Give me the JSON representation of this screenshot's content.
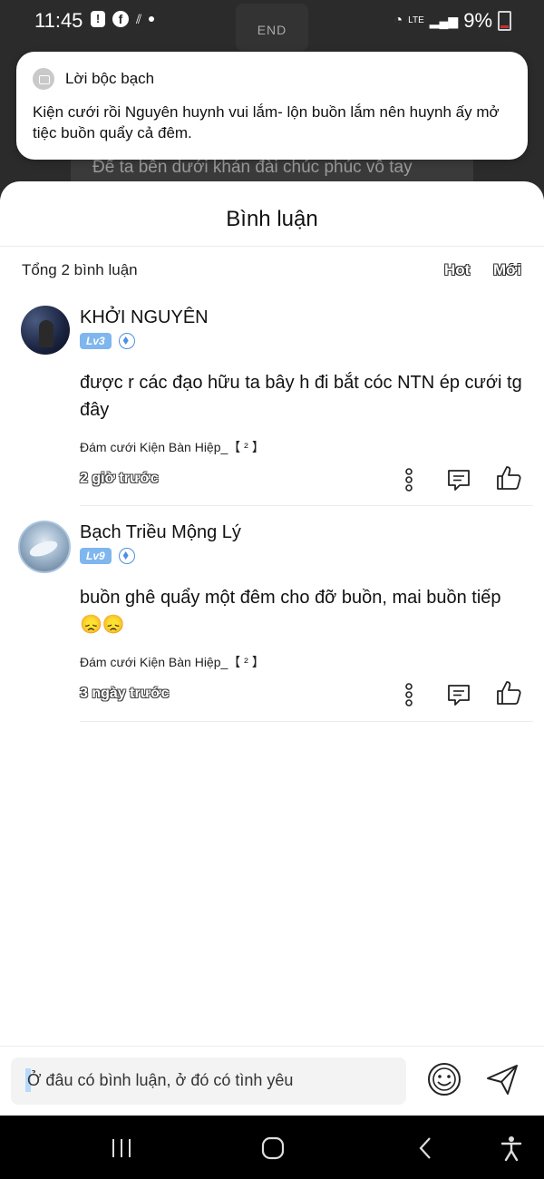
{
  "status_bar": {
    "time": "11:45",
    "center_pill": "END",
    "battery": "9%",
    "network": "LTE"
  },
  "background": {
    "caption": "Để ta bên dưới khán đài chúc phúc vô tay"
  },
  "notification": {
    "title": "Lời bộc bạch",
    "body": "Kiện cưới rồi Nguyên huynh vui lắm- lộn buồn lắm nên huynh ấy mở tiệc buồn quẩy cả đêm."
  },
  "sheet": {
    "title": "Bình luận",
    "count": "Tổng 2 bình luận",
    "sort_hot": "Hot",
    "sort_new": "Mới"
  },
  "comments": [
    {
      "name": "KHỞI NGUYÊN",
      "level": "Lv3",
      "text": "được r các đạo hữu ta bây h đi bắt cóc NTN ép cưới tg đây",
      "source": "Đám cưới Kiện Bàn Hiệp_【 ² 】",
      "time": "2 giờ trước"
    },
    {
      "name": "Bạch Triều Mộng Lý",
      "level": "Lv9",
      "text": "buồn ghê quẩy một đêm cho đỡ buồn, mai buồn tiếp 😞😞",
      "source": "Đám cưới Kiện Bàn Hiệp_【 ² 】",
      "time": "3 ngày trước"
    }
  ],
  "composer": {
    "placeholder": "Ở đâu có bình luận, ở đó có tình yêu"
  },
  "colors": {
    "level_badge": "#7fb6ee",
    "gem": "#4d8fe0",
    "input_bg": "#f3f3f3"
  }
}
